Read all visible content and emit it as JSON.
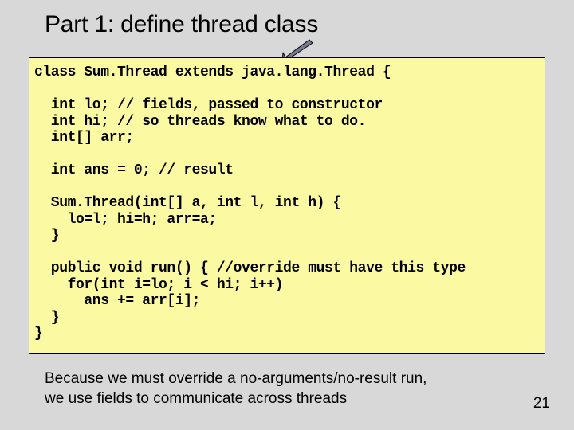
{
  "title": "Part 1: define thread class",
  "code": "class Sum.Thread extends java.lang.Thread {\n\n  int lo; // fields, passed to constructor\n  int hi; // so threads know what to do.\n  int[] arr;\n\n  int ans = 0; // result\n\n  Sum.Thread(int[] a, int l, int h) {\n    lo=l; hi=h; arr=a;\n  }\n\n  public void run() { //override must have this type\n    for(int i=lo; i < hi; i++)\n      ans += arr[i];\n  }\n}",
  "caption_line1": "Because we must override a no-arguments/no-result run,",
  "caption_line2": "we use fields to communicate across threads",
  "page_number": "21"
}
